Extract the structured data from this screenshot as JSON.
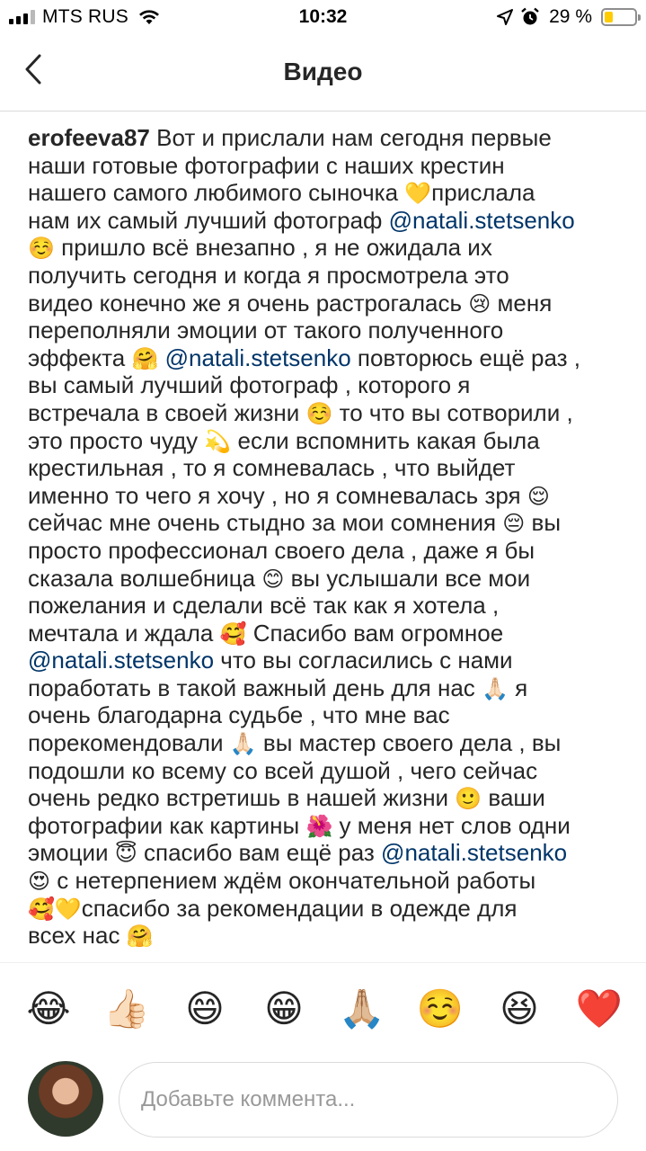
{
  "status_bar": {
    "carrier": "MTS RUS",
    "time": "10:32",
    "battery_percent": "29 %",
    "battery_level": 0.29,
    "signal_bars_filled": 3,
    "signal_bars_total": 4,
    "icons": [
      "signal-icon",
      "wifi-icon",
      "location-arrow-icon",
      "alarm-clock-icon",
      "battery-icon"
    ],
    "battery_color": "#ffcc00"
  },
  "header": {
    "title": "Видео",
    "back_icon": "chevron-left-icon"
  },
  "caption": {
    "username": "erofeeva87",
    "mention": "@natali.stetsenko",
    "lines": [
      [
        {
          "t": "user",
          "v": "erofeeva87"
        },
        {
          "t": "text",
          "v": " Вот и прислали нам сегодня первые"
        }
      ],
      [
        {
          "t": "text",
          "v": "наши готовые фотографии с наших крестин"
        }
      ],
      [
        {
          "t": "text",
          "v": "нашего самого любимого сыночка "
        },
        {
          "t": "emoji",
          "v": "💛"
        },
        {
          "t": "text",
          "v": "прислала"
        }
      ],
      [
        {
          "t": "text",
          "v": "нам их самый лучший фотограф "
        },
        {
          "t": "mention",
          "v": "@natali.stetsenko"
        }
      ],
      [
        {
          "t": "emoji",
          "v": "☺️"
        },
        {
          "t": "text",
          "v": "  пришло всё внезапно , я не ожидала их"
        }
      ],
      [
        {
          "t": "text",
          "v": "получить сегодня и когда я просмотрела это"
        }
      ],
      [
        {
          "t": "text",
          "v": "видео конечно же я очень растрогалась "
        },
        {
          "t": "emoji",
          "v": "😢"
        },
        {
          "t": "text",
          "v": "  меня"
        }
      ],
      [
        {
          "t": "text",
          "v": "переполняли эмоции от такого полученного"
        }
      ],
      [
        {
          "t": "text",
          "v": "эффекта "
        },
        {
          "t": "emoji",
          "v": "🤗"
        },
        {
          "t": "text",
          "v": "  "
        },
        {
          "t": "mention",
          "v": "@natali.stetsenko"
        },
        {
          "t": "text",
          "v": " повторюсь ещё раз ,"
        }
      ],
      [
        {
          "t": "text",
          "v": "вы самый лучший фотограф , которого я"
        }
      ],
      [
        {
          "t": "text",
          "v": "встречала в своей жизни "
        },
        {
          "t": "emoji",
          "v": "☺️"
        },
        {
          "t": "text",
          "v": "  то что вы сотворили ,"
        }
      ],
      [
        {
          "t": "text",
          "v": "это просто чуду "
        },
        {
          "t": "emoji",
          "v": "💫"
        },
        {
          "t": "text",
          "v": "  если вспомнить какая была"
        }
      ],
      [
        {
          "t": "text",
          "v": "крестильная , то я сомневалась , что выйдет"
        }
      ],
      [
        {
          "t": "text",
          "v": "именно то чего я хочу , но я сомневалась зря "
        },
        {
          "t": "emoji",
          "v": "😌"
        }
      ],
      [
        {
          "t": "text",
          "v": "сейчас мне очень стыдно за мои сомнения "
        },
        {
          "t": "emoji",
          "v": "😔"
        },
        {
          "t": "text",
          "v": "  вы"
        }
      ],
      [
        {
          "t": "text",
          "v": "просто профессионал своего дела , даже я бы"
        }
      ],
      [
        {
          "t": "text",
          "v": "сказала волшебница "
        },
        {
          "t": "emoji",
          "v": "😊"
        },
        {
          "t": "text",
          "v": "  вы услышали все мои"
        }
      ],
      [
        {
          "t": "text",
          "v": "пожелания и сделали всё так как я хотела ,"
        }
      ],
      [
        {
          "t": "text",
          "v": "мечтала и ждала "
        },
        {
          "t": "emoji",
          "v": "🥰"
        },
        {
          "t": "text",
          "v": "  Спасибо вам огромное"
        }
      ],
      [
        {
          "t": "mention",
          "v": "@natali.stetsenko"
        },
        {
          "t": "text",
          "v": " что вы согласились с нами"
        }
      ],
      [
        {
          "t": "text",
          "v": "поработать в такой важный день для нас "
        },
        {
          "t": "emoji",
          "v": "🙏🏻"
        },
        {
          "t": "text",
          "v": "  я"
        }
      ],
      [
        {
          "t": "text",
          "v": "очень благодарна судьбе , что мне вас"
        }
      ],
      [
        {
          "t": "text",
          "v": "порекомендовали "
        },
        {
          "t": "emoji",
          "v": "🙏🏻"
        },
        {
          "t": "text",
          "v": "  вы мастер своего дела , вы"
        }
      ],
      [
        {
          "t": "text",
          "v": "подошли ко всему со всей душой , чего сейчас"
        }
      ],
      [
        {
          "t": "text",
          "v": "очень редко встретишь в нашей жизни "
        },
        {
          "t": "emoji",
          "v": "🙂"
        },
        {
          "t": "text",
          "v": "  ваши"
        }
      ],
      [
        {
          "t": "text",
          "v": "фотографии как картины "
        },
        {
          "t": "emoji",
          "v": "🌺"
        },
        {
          "t": "text",
          "v": "  у меня нет слов одни"
        }
      ],
      [
        {
          "t": "text",
          "v": "эмоции "
        },
        {
          "t": "emoji",
          "v": "😇"
        },
        {
          "t": "text",
          "v": "  спасибо вам ещё раз "
        },
        {
          "t": "mention",
          "v": "@natali.stetsenko"
        }
      ],
      [
        {
          "t": "emoji",
          "v": "😍"
        },
        {
          "t": "text",
          "v": "  с нетерпением ждём окончательной работы"
        }
      ],
      [
        {
          "t": "emoji",
          "v": "🥰💛"
        },
        {
          "t": "text",
          "v": "спасибо за рекомендации в одежде для"
        }
      ],
      [
        {
          "t": "text",
          "v": "всех нас "
        },
        {
          "t": "emoji",
          "v": "🤗"
        }
      ]
    ]
  },
  "quick_emojis": [
    {
      "emoji": "😂",
      "name": "tears-of-joy-emoji"
    },
    {
      "emoji": "👍🏻",
      "name": "thumbs-up-emoji"
    },
    {
      "emoji": "😄",
      "name": "smile-emoji"
    },
    {
      "emoji": "😁",
      "name": "grin-emoji"
    },
    {
      "emoji": "🙏🏼",
      "name": "folded-hands-emoji"
    },
    {
      "emoji": "☺️",
      "name": "relaxed-emoji"
    },
    {
      "emoji": "😆",
      "name": "laughing-emoji"
    },
    {
      "emoji": "❤️",
      "name": "red-heart-emoji"
    }
  ],
  "comment": {
    "placeholder": "Добавьте коммента...",
    "value": ""
  },
  "colors": {
    "text": "#262626",
    "mention": "#003569",
    "placeholder": "#999999",
    "divider": "#dbdbdb"
  }
}
